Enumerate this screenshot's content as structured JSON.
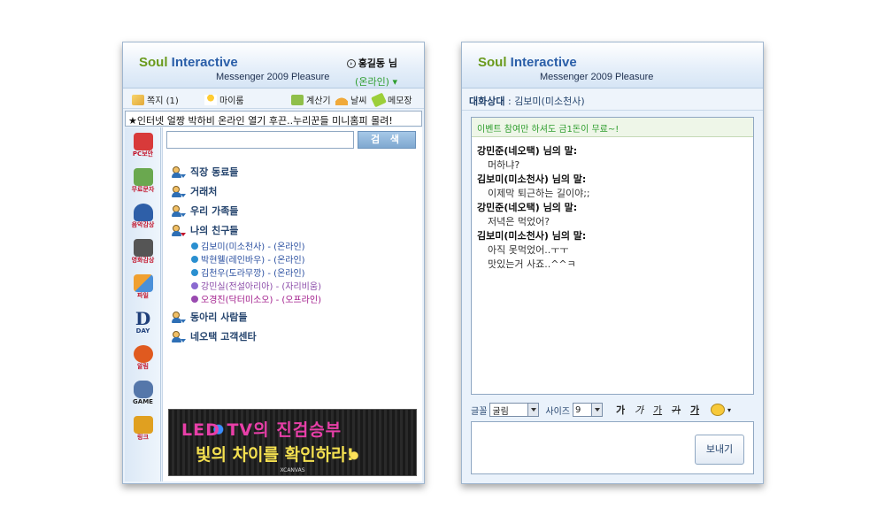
{
  "left_window": {
    "brand_main": "Soul",
    "brand_accent": "Interactive",
    "subbrand": "Messenger 2009 Pleasure",
    "user_name": "홍길동 님",
    "user_status": "(온라인) ▾",
    "toolbar": {
      "note": "쪽지 (1)",
      "myroom": "마이룸",
      "calculator": "계산기",
      "weather": "날씨",
      "memo": "메모장"
    },
    "ticker": "★인터넷 얼짱 박하비 온라인 열기 후끈..누리꾼들 미니홈피 몰려!",
    "sidebar": [
      {
        "label": "PC보안",
        "icon": "shield-icon",
        "color": "#d83a3a"
      },
      {
        "label": "무료문자",
        "icon": "phone-icon",
        "color": "#6aa84f"
      },
      {
        "label": "음악감상",
        "icon": "headphones-icon",
        "color": "#2e5fa8"
      },
      {
        "label": "영화감상",
        "icon": "camera-icon",
        "color": "#555555"
      },
      {
        "label": "파일",
        "icon": "file-transfer-icon",
        "color": "#f0a030"
      },
      {
        "label": "DAY",
        "icon": "dday-icon",
        "color": "#1f3f7a"
      },
      {
        "label": "알림",
        "icon": "alarm-clock-icon",
        "color": "#e05a1f"
      },
      {
        "label": "GAME",
        "icon": "gamepad-icon",
        "color": "#5577aa"
      },
      {
        "label": "링크",
        "icon": "link-icon",
        "color": "#e0a020"
      }
    ],
    "search_button": "검 색",
    "groups": [
      {
        "name": "직장 동료들"
      },
      {
        "name": "거래처"
      },
      {
        "name": "우리 가족들"
      },
      {
        "name": "나의 친구들"
      },
      {
        "name": "동아리 사람들"
      },
      {
        "name": "네오택 고객센타"
      }
    ],
    "contacts": [
      {
        "name": "김보미(미소천사) - (온라인)",
        "color": "#2a4fa0",
        "dot": "#2a8fd0"
      },
      {
        "name": "박현웰(레인바우) - (온라인)",
        "color": "#2a4fa0",
        "dot": "#2a8fd0"
      },
      {
        "name": "김천우(도라무깡) - (온라인)",
        "color": "#2a4fa0",
        "dot": "#2a8fd0"
      },
      {
        "name": "강민실(전설아리아) - (자리비움)",
        "color": "#8a4aa8",
        "dot": "#8a6ad0"
      },
      {
        "name": "오경진(닥터미소오) - (오프라인)",
        "color": "#a01a8a",
        "dot": "#9a4ab0"
      }
    ],
    "banner": {
      "line1": "LED TV의 진검승부",
      "line2": "빛의 차이를 확인하라!",
      "foot": "XCANVAS"
    }
  },
  "right_window": {
    "brand_main": "Soul",
    "brand_accent": "Interactive",
    "subbrand": "Messenger 2009 Pleasure",
    "partner_label": "대화상대",
    "partner_name": "김보미(미소천사)",
    "event": "이벤트 참여만 하셔도 금1돈이 무료~!",
    "messages": [
      {
        "sender": "강민준(네오택) 님의 말:",
        "lines": [
          "머하냐?"
        ]
      },
      {
        "sender": "김보미(미소천사) 님의 말:",
        "lines": [
          "이제막 퇴근하는 길이야;;"
        ]
      },
      {
        "sender": "강민준(네오택) 님의 말:",
        "lines": [
          "저녁은 먹었어?"
        ]
      },
      {
        "sender": "김보미(미소천사) 님의 말:",
        "lines": [
          "아직 못먹었어..ㅜㅜ",
          "맛있는거 사죠..^^ㅋ"
        ]
      }
    ],
    "format": {
      "font_label": "글꼴",
      "font_value": "굴림",
      "size_label": "사이즈",
      "size_value": "9",
      "styles": [
        "가",
        "가",
        "가",
        "가",
        "가"
      ]
    },
    "send_button": "보내기"
  },
  "colors": {
    "brand_green": "#6a9a1c",
    "brand_blue": "#2a5ea8",
    "online_green": "#2d9d2d"
  }
}
